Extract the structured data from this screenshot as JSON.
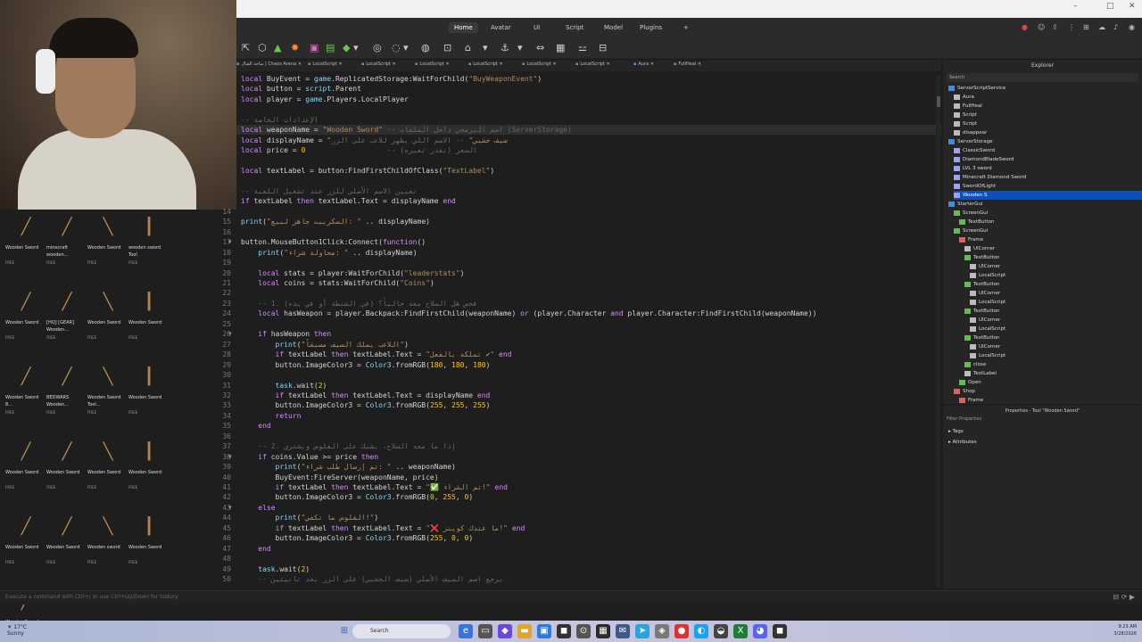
{
  "menu": {
    "tabs": [
      "Home",
      "Avatar",
      "UI",
      "Script",
      "Model",
      "Plugins",
      "+"
    ],
    "active": "Home"
  },
  "file_tabs": [
    "ساحة القتال | Chaos Arena",
    "LocalScript",
    "LocalScript",
    "LocalScript",
    "LocalScript",
    "LocalScript",
    "LocalScript",
    "Aura",
    "FullHeal"
  ],
  "code_lines": [
    {
      "n": "",
      "t": "local BuyEvent = game.ReplicatedStorage:WaitForChild(\"BuyWeaponEvent\")"
    },
    {
      "n": "",
      "t": "local button = script.Parent"
    },
    {
      "n": "",
      "t": "local player = game.Players.LocalPlayer"
    },
    {
      "n": "",
      "t": ""
    },
    {
      "n": "",
      "t": "-- الإعدادات الخاصة"
    },
    {
      "n": "",
      "t": "local weaponName = \"Wooden Sword\" -- اسم البرمجي داخل الملفات (ServerStorage)"
    },
    {
      "n": "",
      "t": "local displayName = \"سيف خشبي\" -- الاسم اللي يظهر للاعب على الزر"
    },
    {
      "n": "",
      "t": "local price = 0                   -- السعر (تقدر تغيره)"
    },
    {
      "n": "",
      "t": ""
    },
    {
      "n": "",
      "t": "local textLabel = button:FindFirstChildOfClass(\"TextLabel\")"
    },
    {
      "n": "",
      "t": ""
    },
    {
      "n": "",
      "t": "-- تعيين الاسم الأصلي للزر عند تشغيل اللعبة"
    },
    {
      "n": "",
      "t": "if textLabel then textLabel.Text = displayName end"
    },
    {
      "n": "14",
      "t": ""
    },
    {
      "n": "15",
      "t": "print(\"السكريبت جاهز لبيع: \" .. displayName)"
    },
    {
      "n": "16",
      "t": ""
    },
    {
      "n": "17",
      "t": "button.MouseButton1Click:Connect(function()"
    },
    {
      "n": "18",
      "t": "    print(\"محاولة شراء: \" .. displayName)"
    },
    {
      "n": "19",
      "t": ""
    },
    {
      "n": "20",
      "t": "    local stats = player:WaitForChild(\"leaderstats\")"
    },
    {
      "n": "21",
      "t": "    local coins = stats:WaitForChild(\"Coins\")"
    },
    {
      "n": "22",
      "t": ""
    },
    {
      "n": "23",
      "t": "    -- 1. فحص هل السلاح معه حالياً؟ (في الشنطة أو في يده)"
    },
    {
      "n": "24",
      "t": "    local hasWeapon = player.Backpack:FindFirstChild(weaponName) or (player.Character and player.Character:FindFirstChild(weaponName))"
    },
    {
      "n": "25",
      "t": ""
    },
    {
      "n": "26",
      "t": "    if hasWeapon then"
    },
    {
      "n": "27",
      "t": "        print(\"اللاعب يملك السيف مسبقاً\")"
    },
    {
      "n": "28",
      "t": "        if textLabel then textLabel.Text = \"تملكه بالفعل ✔\" end"
    },
    {
      "n": "29",
      "t": "        button.ImageColor3 = Color3.fromRGB(180, 180, 180)"
    },
    {
      "n": "30",
      "t": ""
    },
    {
      "n": "31",
      "t": "        task.wait(2)"
    },
    {
      "n": "32",
      "t": "        if textLabel then textLabel.Text = displayName end"
    },
    {
      "n": "33",
      "t": "        button.ImageColor3 = Color3.fromRGB(255, 255, 255)"
    },
    {
      "n": "34",
      "t": "        return"
    },
    {
      "n": "35",
      "t": "    end"
    },
    {
      "n": "36",
      "t": ""
    },
    {
      "n": "37",
      "t": "    -- 2. إذا ما معه السلاح، يشيك على الفلوس ويشتري"
    },
    {
      "n": "38",
      "t": "    if coins.Value >= price then"
    },
    {
      "n": "39",
      "t": "        print(\"تم إرسال طلب شراء: \" .. weaponName)"
    },
    {
      "n": "40",
      "t": "        BuyEvent:FireServer(weaponName, price)"
    },
    {
      "n": "41",
      "t": "        if textLabel then textLabel.Text = \"✅ تم الشراء!\" end"
    },
    {
      "n": "42",
      "t": "        button.ImageColor3 = Color3.fromRGB(0, 255, 0)"
    },
    {
      "n": "43",
      "t": "    else"
    },
    {
      "n": "44",
      "t": "        print(\"الفلوس ما تكفي!\")"
    },
    {
      "n": "45",
      "t": "        if textLabel then textLabel.Text = \"❌ ما عندك كوينز!\" end"
    },
    {
      "n": "46",
      "t": "        button.ImageColor3 = Color3.fromRGB(255, 0, 0)"
    },
    {
      "n": "47",
      "t": "    end"
    },
    {
      "n": "48",
      "t": ""
    },
    {
      "n": "49",
      "t": "    task.wait(2)"
    },
    {
      "n": "50",
      "t": "    -- يرجع اسم السيف الأصلي (سيف الخشبي) على الزر بعد ثانيتين"
    }
  ],
  "assets": [
    {
      "name": "Wooden Sword",
      "free": "FREE"
    },
    {
      "name": "minecraft wooden...",
      "free": "FREE"
    },
    {
      "name": "Wooden Sword",
      "free": "FREE"
    },
    {
      "name": "wooden sword Tool",
      "free": "FREE"
    },
    {
      "name": "Wooden Sword",
      "free": "FREE"
    },
    {
      "name": "[HQ] [GEAR] Wooden...",
      "free": "FREE"
    },
    {
      "name": "Wooden Sword",
      "free": "FREE"
    },
    {
      "name": "Wooden Sword",
      "free": "FREE"
    },
    {
      "name": "Wooden Sword 8...",
      "free": "FREE"
    },
    {
      "name": "BEDWARS Wooden...",
      "free": "FREE"
    },
    {
      "name": "Wooden Sword Tool...",
      "free": "FREE"
    },
    {
      "name": "Wooden Sword",
      "free": "FREE"
    },
    {
      "name": "Wooden Sword",
      "free": "FREE"
    },
    {
      "name": "Wooden Sword",
      "free": "FREE"
    },
    {
      "name": "Wooden Sword",
      "free": "FREE"
    },
    {
      "name": "Wooden Sword",
      "free": "FREE"
    },
    {
      "name": "Wooden Sword",
      "free": "FREE"
    },
    {
      "name": "Wooden Sword",
      "free": "FREE"
    },
    {
      "name": "Wooden sword",
      "free": "FREE"
    },
    {
      "name": "Wooden Sword",
      "free": "FREE"
    },
    {
      "name": "Wooden Sword",
      "free": "FREE"
    }
  ],
  "explorer": {
    "title": "Explorer",
    "search": "Search",
    "nodes": [
      {
        "label": "ServerScriptService",
        "icon": "blue"
      },
      {
        "label": "Aura",
        "icon": "doc"
      },
      {
        "label": "FullHeal",
        "icon": "doc"
      },
      {
        "label": "Script",
        "icon": "doc"
      },
      {
        "label": "Script",
        "icon": "doc"
      },
      {
        "label": "disappear",
        "icon": "doc"
      },
      {
        "label": "ServerStorage",
        "icon": "blue"
      },
      {
        "label": "ClassicSword",
        "icon": "tool"
      },
      {
        "label": "DiamondBladeSword",
        "icon": "tool"
      },
      {
        "label": "LVL 3 sword",
        "icon": "tool"
      },
      {
        "label": "Minecraft Diamond Sword",
        "icon": "tool"
      },
      {
        "label": "SwordOfLight",
        "icon": "tool"
      },
      {
        "label": "Wooden S",
        "icon": "tool"
      },
      {
        "label": "StarterGui",
        "icon": "blue"
      },
      {
        "label": "ScreenGui",
        "icon": "green"
      },
      {
        "label": "TextButton",
        "icon": "green"
      },
      {
        "label": "ScreenGui",
        "icon": "green"
      },
      {
        "label": "Frame",
        "icon": "red"
      },
      {
        "label": "UICorner",
        "icon": "doc"
      },
      {
        "label": "TextButton",
        "icon": "green"
      },
      {
        "label": "UICorner",
        "icon": "doc"
      },
      {
        "label": "LocalScript",
        "icon": "doc"
      },
      {
        "label": "TextButton",
        "icon": "green"
      },
      {
        "label": "UICorner",
        "icon": "doc"
      },
      {
        "label": "LocalScript",
        "icon": "doc"
      },
      {
        "label": "TextButton",
        "icon": "green"
      },
      {
        "label": "UICorner",
        "icon": "doc"
      },
      {
        "label": "LocalScript",
        "icon": "doc"
      },
      {
        "label": "TextButton",
        "icon": "green"
      },
      {
        "label": "UICorner",
        "icon": "doc"
      },
      {
        "label": "LocalScript",
        "icon": "doc"
      },
      {
        "label": "close",
        "icon": "green"
      },
      {
        "label": "TextLabel",
        "icon": "doc"
      },
      {
        "label": "Open",
        "icon": "green"
      },
      {
        "label": "Shop",
        "icon": "red"
      },
      {
        "label": "Frame",
        "icon": "red"
      }
    ]
  },
  "properties": {
    "title": "Properties - Tool \"Wooden Sword\"",
    "filter": "Filter Properties",
    "sections": [
      "Tags",
      "Attributes"
    ]
  },
  "command_bar": {
    "placeholder": "Execute a command with Ctrl+/ or use Ctrl+Up/Down for history"
  },
  "taskbar": {
    "weather_temp": "17°C",
    "weather_text": "Sunny",
    "search": "Search",
    "time": "9:23 AM",
    "date": "3/28/2026"
  },
  "colors": {
    "keyword": "#d78bff",
    "string": "#ad8f5e",
    "comment": "#666666",
    "number": "#ffc600",
    "builtin": "#84d6f7",
    "selection": "#0b4fb8"
  }
}
